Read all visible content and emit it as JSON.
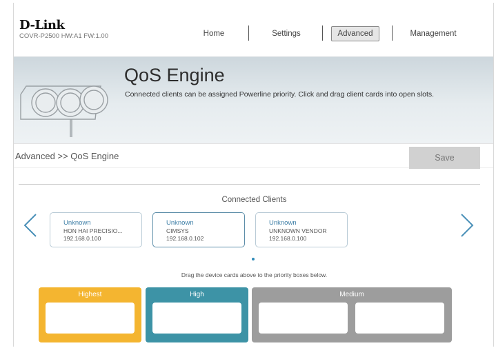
{
  "brand": {
    "logo": "D-Link",
    "model_info": "COVR-P2500   HW:A1   FW:1.00"
  },
  "nav": {
    "home": "Home",
    "settings": "Settings",
    "advanced": "Advanced",
    "management": "Management",
    "active": "Advanced"
  },
  "banner": {
    "title": "QoS Engine",
    "description": "Connected clients can be assigned Powerline priority. Click and drag client cards into open slots."
  },
  "breadcrumb": "Advanced >> QoS Engine",
  "save_label": "Save",
  "connected_clients": {
    "title": "Connected Clients",
    "cards": [
      {
        "name": "Unknown",
        "vendor": "HON HAI PRECISIO...",
        "ip": "192.168.0.100"
      },
      {
        "name": "Unknown",
        "vendor": "CIMSYS",
        "ip": "192.168.0.102"
      },
      {
        "name": "Unknown",
        "vendor": "UNKNOWN VENDOR",
        "ip": "192.168.0.100"
      }
    ],
    "drag_hint": "Drag the device cards above to the priority boxes below."
  },
  "priority": {
    "highest": "Highest",
    "high": "High",
    "medium": "Medium"
  },
  "colors": {
    "highest": "#f4b530",
    "high": "#3d93a6",
    "medium": "#9d9d9d",
    "accent": "#3d7ea6"
  },
  "icons": {
    "prev": "chevron-left-icon",
    "next": "chevron-right-icon",
    "banner": "traffic-light-illustration"
  }
}
